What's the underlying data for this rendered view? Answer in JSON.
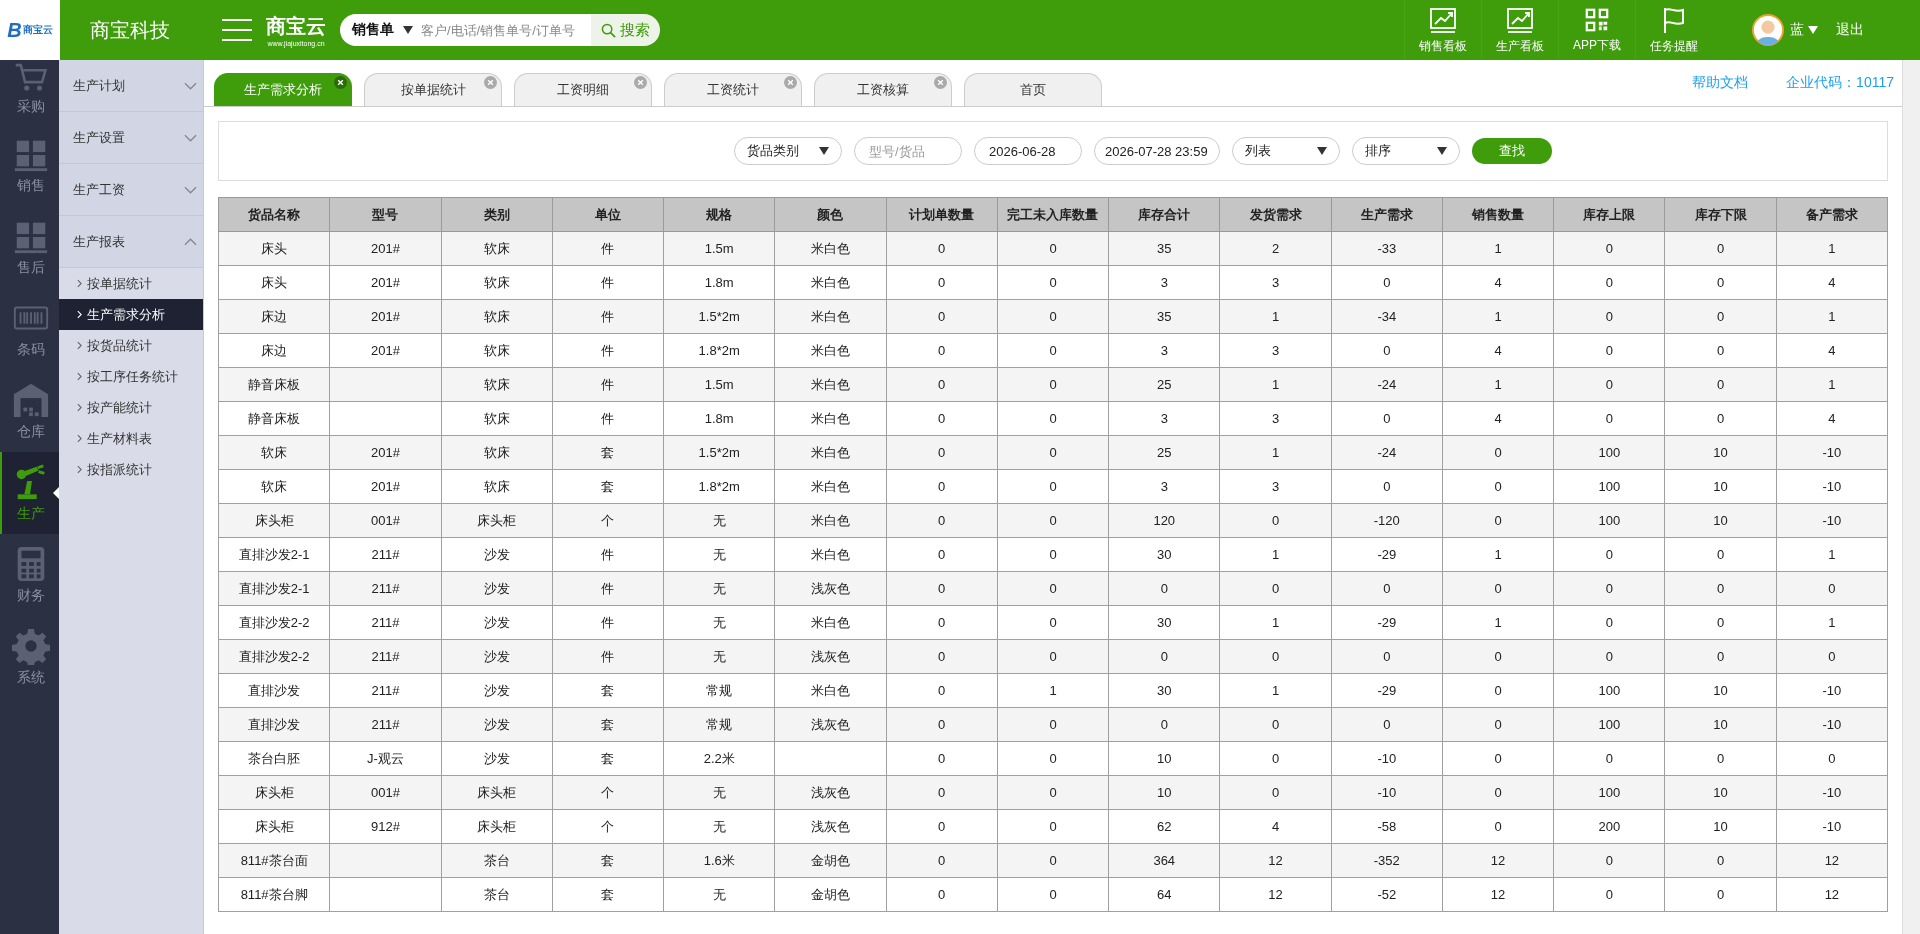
{
  "header": {
    "logo_mark": "B",
    "logo_text": "商宝云",
    "company": "商宝科技",
    "brand": "商宝云",
    "brand_url": "www.jiajuxitong.cn",
    "search": {
      "scope": "销售单",
      "placeholder": "客户/电话/销售单号/订单号",
      "button": "搜索"
    },
    "tools": [
      {
        "label": "销售看板"
      },
      {
        "label": "生产看板"
      },
      {
        "label": "APP下载"
      },
      {
        "label": "任务提醒"
      }
    ],
    "user": {
      "name": "蓝",
      "logout": "退出"
    }
  },
  "rail": [
    {
      "label": "采购",
      "selected": false
    },
    {
      "label": "销售",
      "selected": false
    },
    {
      "label": "售后",
      "selected": false
    },
    {
      "label": "条码",
      "selected": false
    },
    {
      "label": "仓库",
      "selected": false
    },
    {
      "label": "生产",
      "selected": true
    },
    {
      "label": "财务",
      "selected": false
    },
    {
      "label": "系统",
      "selected": false
    }
  ],
  "submenu": [
    {
      "label": "生产计划",
      "expanded": false
    },
    {
      "label": "生产设置",
      "expanded": false
    },
    {
      "label": "生产工资",
      "expanded": false
    },
    {
      "label": "生产报表",
      "expanded": true,
      "children": [
        {
          "label": "按单据统计",
          "selected": false
        },
        {
          "label": "生产需求分析",
          "selected": true
        },
        {
          "label": "按货品统计",
          "selected": false
        },
        {
          "label": "按工序任务统计",
          "selected": false
        },
        {
          "label": "按产能统计",
          "selected": false
        },
        {
          "label": "生产材料表",
          "selected": false
        },
        {
          "label": "按指派统计",
          "selected": false
        }
      ]
    }
  ],
  "tabs": [
    {
      "label": "生产需求分析",
      "selected": true,
      "closable": true
    },
    {
      "label": "按单据统计",
      "selected": false,
      "closable": true
    },
    {
      "label": "工资明细",
      "selected": false,
      "closable": true
    },
    {
      "label": "工资统计",
      "selected": false,
      "closable": true
    },
    {
      "label": "工资核算",
      "selected": false,
      "closable": true
    },
    {
      "label": "首页",
      "selected": false,
      "closable": false
    }
  ],
  "help_link": "帮助文档",
  "company_code": "企业代码：10117",
  "filters": [
    {
      "kind": "select",
      "value": "货品类别"
    },
    {
      "kind": "input",
      "placeholder": "型号/货品"
    },
    {
      "kind": "input",
      "value": "2026-06-28"
    },
    {
      "kind": "input",
      "value": "2026-07-28 23:59"
    },
    {
      "kind": "select",
      "value": "列表"
    },
    {
      "kind": "select",
      "value": "排序"
    },
    {
      "kind": "button",
      "value": "查找"
    }
  ],
  "table": {
    "columns": [
      "货品名称",
      "型号",
      "类别",
      "单位",
      "规格",
      "颜色",
      "计划单数量",
      "完工未入库数量",
      "库存合计",
      "发货需求",
      "生产需求",
      "销售数量",
      "库存上限",
      "库存下限",
      "备产需求"
    ],
    "rows": [
      [
        "床头",
        "201#",
        "软床",
        "件",
        "1.5m",
        "米白色",
        "0",
        "0",
        "35",
        "2",
        "-33",
        "1",
        "0",
        "0",
        "1"
      ],
      [
        "床头",
        "201#",
        "软床",
        "件",
        "1.8m",
        "米白色",
        "0",
        "0",
        "3",
        "3",
        "0",
        "4",
        "0",
        "0",
        "4"
      ],
      [
        "床边",
        "201#",
        "软床",
        "件",
        "1.5*2m",
        "米白色",
        "0",
        "0",
        "35",
        "1",
        "-34",
        "1",
        "0",
        "0",
        "1"
      ],
      [
        "床边",
        "201#",
        "软床",
        "件",
        "1.8*2m",
        "米白色",
        "0",
        "0",
        "3",
        "3",
        "0",
        "4",
        "0",
        "0",
        "4"
      ],
      [
        "静音床板",
        null,
        "软床",
        "件",
        "1.5m",
        "米白色",
        "0",
        "0",
        "25",
        "1",
        "-24",
        "1",
        "0",
        "0",
        "1"
      ],
      [
        "静音床板",
        null,
        "软床",
        "件",
        "1.8m",
        "米白色",
        "0",
        "0",
        "3",
        "3",
        "0",
        "4",
        "0",
        "0",
        "4"
      ],
      [
        "软床",
        "201#",
        "软床",
        "套",
        "1.5*2m",
        "米白色",
        "0",
        "0",
        "25",
        "1",
        "-24",
        "0",
        "100",
        "10",
        "-10"
      ],
      [
        "软床",
        "201#",
        "软床",
        "套",
        "1.8*2m",
        "米白色",
        "0",
        "0",
        "3",
        "3",
        "0",
        "0",
        "100",
        "10",
        "-10"
      ],
      [
        "床头柜",
        "001#",
        "床头柜",
        "个",
        "无",
        "米白色",
        "0",
        "0",
        "120",
        "0",
        "-120",
        "0",
        "100",
        "10",
        "-10"
      ],
      [
        "直排沙发2-1",
        "211#",
        "沙发",
        "件",
        "无",
        "米白色",
        "0",
        "0",
        "30",
        "1",
        "-29",
        "1",
        "0",
        "0",
        "1"
      ],
      [
        "直排沙发2-1",
        "211#",
        "沙发",
        "件",
        "无",
        "浅灰色",
        "0",
        "0",
        "0",
        "0",
        "0",
        "0",
        "0",
        "0",
        "0"
      ],
      [
        "直排沙发2-2",
        "211#",
        "沙发",
        "件",
        "无",
        "米白色",
        "0",
        "0",
        "30",
        "1",
        "-29",
        "1",
        "0",
        "0",
        "1"
      ],
      [
        "直排沙发2-2",
        "211#",
        "沙发",
        "件",
        "无",
        "浅灰色",
        "0",
        "0",
        "0",
        "0",
        "0",
        "0",
        "0",
        "0",
        "0"
      ],
      [
        "直排沙发",
        "211#",
        "沙发",
        "套",
        "常规",
        "米白色",
        "0",
        "1",
        "30",
        "1",
        "-29",
        "0",
        "100",
        "10",
        "-10"
      ],
      [
        "直排沙发",
        "211#",
        "沙发",
        "套",
        "常规",
        "浅灰色",
        "0",
        "0",
        "0",
        "0",
        "0",
        "0",
        "100",
        "10",
        "-10"
      ],
      [
        "茶台白胚",
        "J-观云",
        "沙发",
        "套",
        "2.2米",
        null,
        "0",
        "0",
        "10",
        "0",
        "-10",
        "0",
        "0",
        "0",
        "0"
      ],
      [
        "床头柜",
        "001#",
        "床头柜",
        "个",
        "无",
        "浅灰色",
        "0",
        "0",
        "10",
        "0",
        "-10",
        "0",
        "100",
        "10",
        "-10"
      ],
      [
        "床头柜",
        "912#",
        "床头柜",
        "个",
        "无",
        "浅灰色",
        "0",
        "0",
        "62",
        "4",
        "-58",
        "0",
        "200",
        "10",
        "-10"
      ],
      [
        "811#茶台面",
        null,
        "茶台",
        "套",
        "1.6米",
        "金胡色",
        "0",
        "0",
        "364",
        "12",
        "-352",
        "12",
        "0",
        "0",
        "12"
      ],
      [
        "811#茶台脚",
        null,
        "茶台",
        "套",
        "无",
        "金胡色",
        "0",
        "0",
        "64",
        "12",
        "-52",
        "12",
        "0",
        "0",
        "12"
      ]
    ]
  }
}
